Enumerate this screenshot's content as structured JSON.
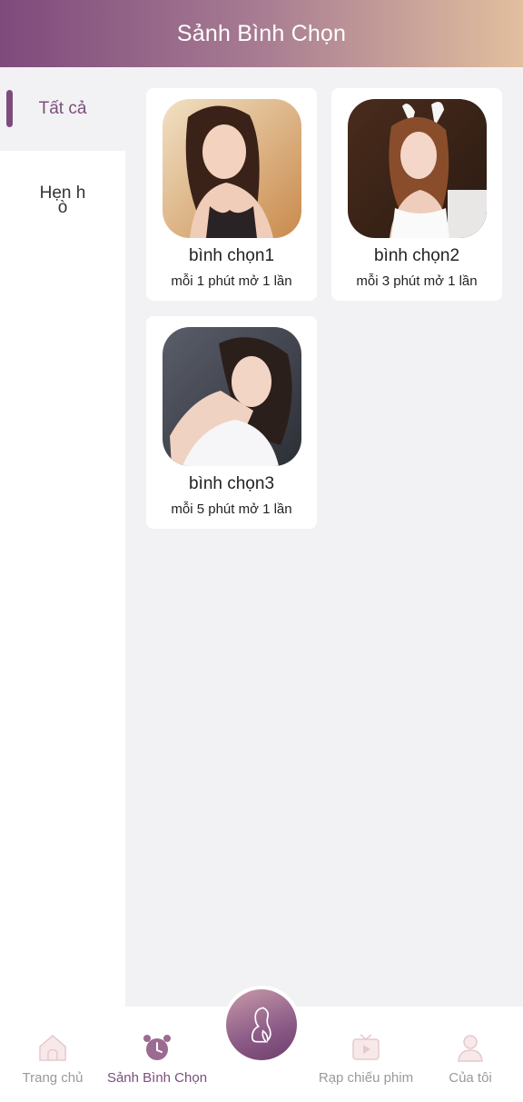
{
  "header": {
    "title": "Sảnh Bình Chọn"
  },
  "sidebar": {
    "items": [
      {
        "label": "Tất cả",
        "active": true
      },
      {
        "label": "Hẹn hò",
        "active": false
      }
    ]
  },
  "cards": [
    {
      "name": "bình chọn1",
      "freq": "mỗi 1 phút mở 1 lần"
    },
    {
      "name": "bình chọn2",
      "freq": "mỗi 3 phút mở 1 lần"
    },
    {
      "name": "bình chọn3",
      "freq": "mỗi 5 phút mở 1 lần"
    }
  ],
  "tabbar": {
    "items": [
      {
        "label": "Trang chủ",
        "icon": "home-icon"
      },
      {
        "label": "Sảnh Bình Chọn",
        "icon": "alarm-clock-icon",
        "active": true
      },
      {
        "label": "Rạp chiếu phim",
        "icon": "tv-play-icon"
      },
      {
        "label": "Của tôi",
        "icon": "user-icon"
      }
    ],
    "center_icon": "woman-silhouette-icon"
  },
  "colors": {
    "accent": "#7c4d7a",
    "header_start": "#7e4a7c",
    "header_end": "#e2bf9e",
    "inactive": "#9a9a9a"
  }
}
